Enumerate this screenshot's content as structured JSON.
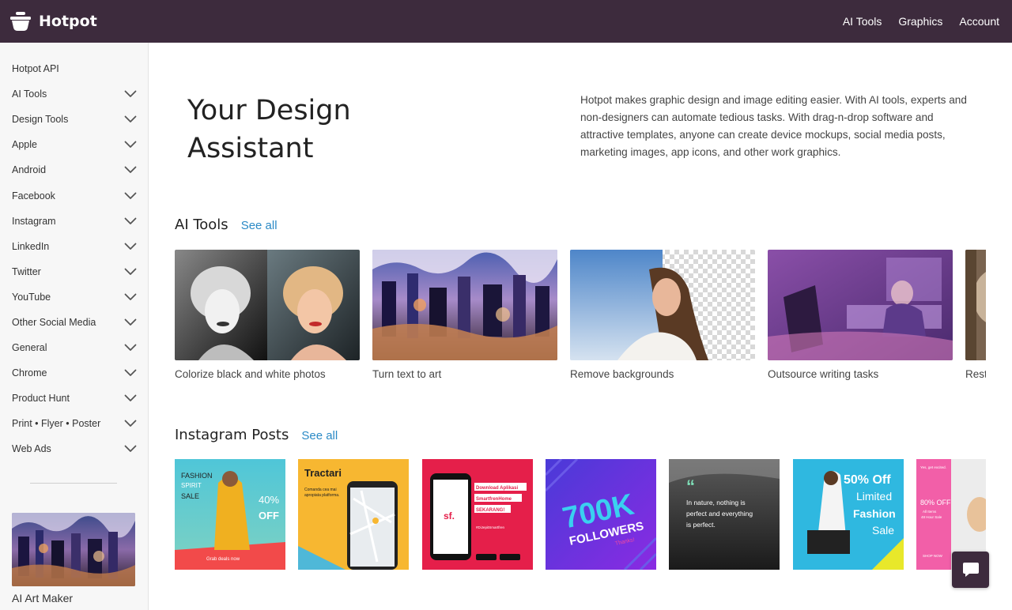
{
  "header": {
    "logo_text": "Hotpot",
    "logo_icon": "hotpot-bowl-icon",
    "nav": [
      "AI Tools",
      "Graphics",
      "Account"
    ]
  },
  "sidebar": {
    "items": [
      {
        "label": "Hotpot API",
        "expandable": false
      },
      {
        "label": "AI Tools",
        "expandable": true
      },
      {
        "label": "Design Tools",
        "expandable": true
      },
      {
        "label": "Apple",
        "expandable": true
      },
      {
        "label": "Android",
        "expandable": true
      },
      {
        "label": "Facebook",
        "expandable": true
      },
      {
        "label": "Instagram",
        "expandable": true
      },
      {
        "label": "LinkedIn",
        "expandable": true
      },
      {
        "label": "Twitter",
        "expandable": true
      },
      {
        "label": "YouTube",
        "expandable": true
      },
      {
        "label": "Other Social Media",
        "expandable": true
      },
      {
        "label": "General",
        "expandable": true
      },
      {
        "label": "Chrome",
        "expandable": true
      },
      {
        "label": "Product Hunt",
        "expandable": true
      },
      {
        "label": "Print • Flyer • Poster",
        "expandable": true
      },
      {
        "label": "Web Ads",
        "expandable": true
      }
    ],
    "featured_label": "AI Art Maker"
  },
  "hero": {
    "title": "Your Design Assistant",
    "description": "Hotpot makes graphic design and image editing easier. With AI tools, experts and non-designers can automate tedious tasks. With drag-n-drop software and attractive templates, anyone can create device mockups, social media posts, marketing images, app icons, and other work graphics."
  },
  "ai_tools": {
    "title": "AI Tools",
    "see_all": "See all",
    "cards": [
      {
        "caption": "Colorize black and white photos"
      },
      {
        "caption": "Turn text to art"
      },
      {
        "caption": "Remove backgrounds"
      },
      {
        "caption": "Outsource writing tasks"
      },
      {
        "caption": "Rest"
      }
    ]
  },
  "instagram": {
    "title": "Instagram Posts",
    "see_all": "See all",
    "posts": [
      {
        "lines": [
          "FASHION",
          "SPIRIT",
          "SALE",
          "40%",
          "OFF",
          "Grab deals now"
        ]
      },
      {
        "lines": [
          "Tractari",
          "Comanda cea mai",
          "apropiata platforma."
        ]
      },
      {
        "lines": [
          "Download Aplikasi",
          "SmartfrenHome",
          "SEKARANG!",
          "#DiJepitSmartfren"
        ]
      },
      {
        "lines": [
          "700K",
          "FOLLOWERS",
          "Thanks!"
        ]
      },
      {
        "lines": [
          "In nature, nothing is",
          "perfect and everything",
          "is perfect."
        ]
      },
      {
        "lines": [
          "50% Off",
          "Limited",
          "Fashion",
          "Sale"
        ]
      },
      {
        "lines": [
          "Yes, get excited.",
          "80% OFF",
          "All Items",
          "48 Hour Sale",
          "SHOP NOW"
        ]
      }
    ]
  },
  "chat": {
    "icon": "chat-bubble-icon"
  },
  "colors": {
    "header_bg": "#3d2b3d",
    "link": "#2b8ac6",
    "sidebar_bg": "#f7f7f7"
  }
}
